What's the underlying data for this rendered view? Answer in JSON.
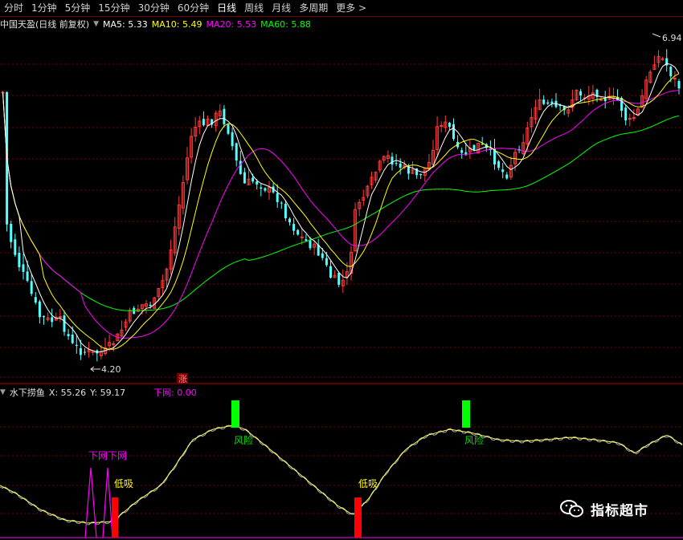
{
  "toolbar": {
    "tabs": [
      {
        "label": "分时"
      },
      {
        "label": "1分钟"
      },
      {
        "label": "5分钟"
      },
      {
        "label": "15分钟"
      },
      {
        "label": "30分钟"
      },
      {
        "label": "60分钟"
      },
      {
        "label": "日线",
        "active": true
      },
      {
        "label": "周线"
      },
      {
        "label": "月线"
      },
      {
        "label": "多周期"
      },
      {
        "label": "更多"
      }
    ],
    "more_arrow": ">"
  },
  "main_chart": {
    "title": "中国天盈(日线 前复权)",
    "ma": [
      {
        "label": "MA5: 5.33",
        "color": "#ffffff"
      },
      {
        "label": "MA10: 5.49",
        "color": "#ffff00"
      },
      {
        "label": "MA20: 5.53",
        "color": "#ff00ff"
      },
      {
        "label": "MA60: 5.88",
        "color": "#00ff00"
      }
    ],
    "high_label": "6.94",
    "low_label": "4.20",
    "zhang_badge": "涨"
  },
  "indicator": {
    "name": "水下捞鱼",
    "x_label": "X: 55.26",
    "y_label": "Y: 59.17",
    "net_label": "下网: 0.00",
    "risk_label": "风险",
    "buy_label": "低吸",
    "net_text": "下网下网"
  },
  "colors": {
    "up": "#ff3a3a",
    "down": "#54ffff",
    "ma5": "#ffffff",
    "ma10": "#ffff00",
    "ma20": "#ff00ff",
    "ma60": "#00ff00",
    "grid": "#7a0000",
    "risk": "#00ff00",
    "buy": "#ff0000"
  },
  "watermark": {
    "icon": "wechat-icon",
    "text": "指标超市"
  }
}
